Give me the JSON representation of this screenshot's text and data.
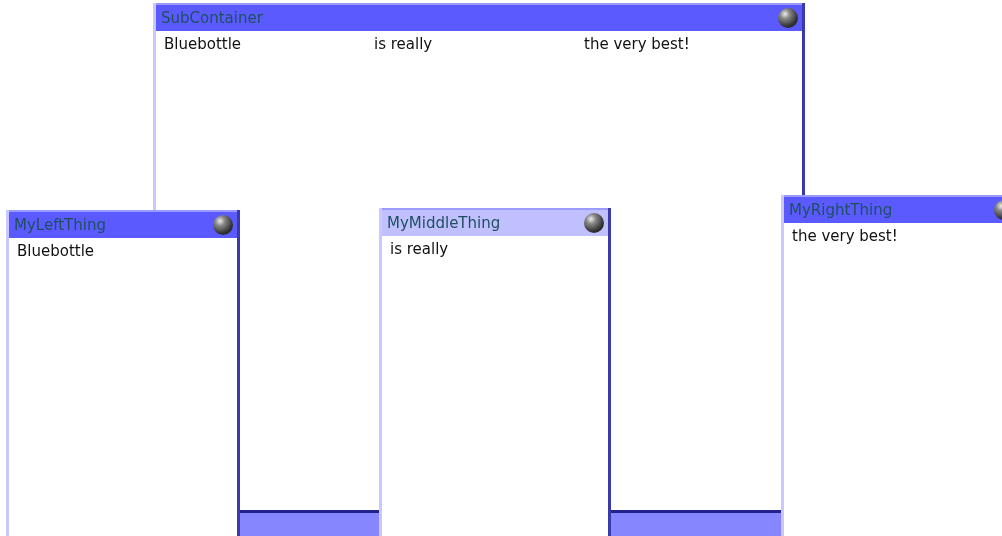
{
  "container": {
    "title": "SubContainer",
    "active": true,
    "columns": [
      "Bluebottle",
      "is really",
      "the very best!"
    ]
  },
  "windows": [
    {
      "title": "MyLeftThing",
      "active": true,
      "text": "Bluebottle"
    },
    {
      "title": "MyMiddleThing",
      "active": false,
      "text": "is really"
    },
    {
      "title": "MyRightThing",
      "active": true,
      "text": "the very best!"
    }
  ]
}
